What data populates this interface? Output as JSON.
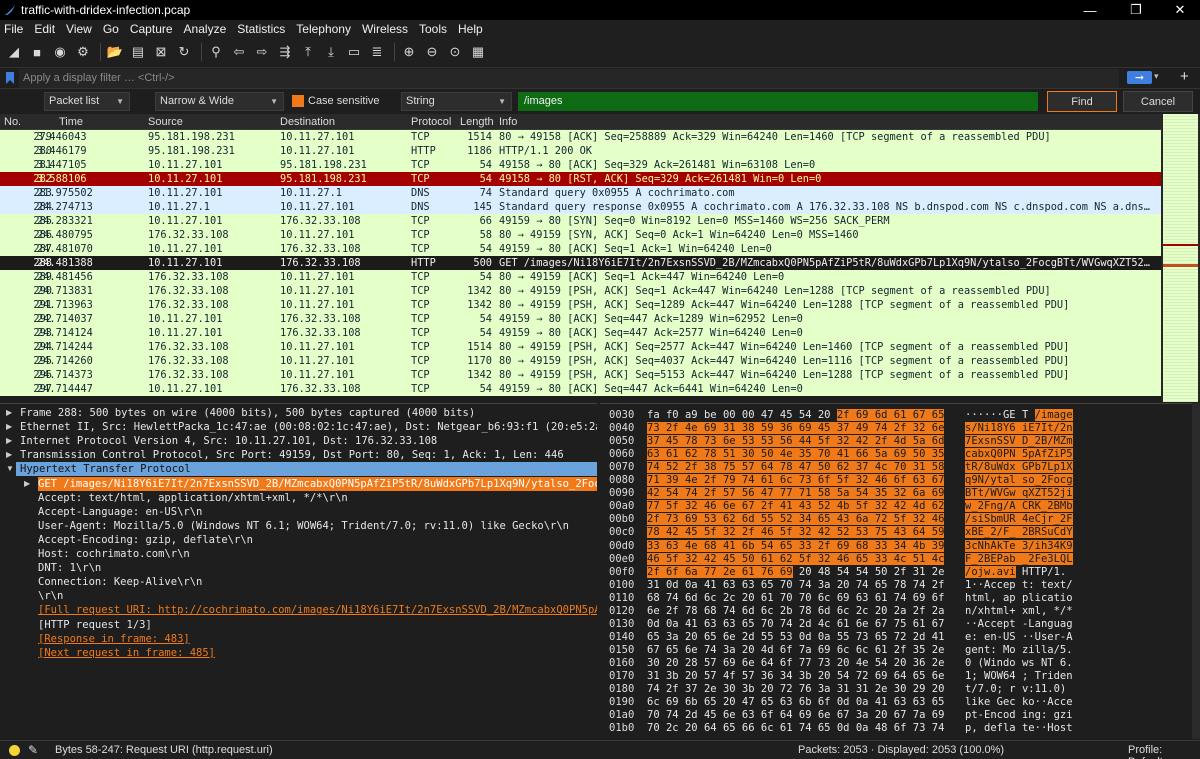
{
  "window": {
    "title": "traffic-with-dridex-infection.pcap",
    "controls": [
      "—",
      "❐",
      "✕"
    ]
  },
  "menu": [
    "File",
    "Edit",
    "View",
    "Go",
    "Capture",
    "Analyze",
    "Statistics",
    "Telephony",
    "Wireless",
    "Tools",
    "Help"
  ],
  "toolbar": {
    "icons": [
      {
        "name": "shark-fin-start-icon",
        "glyph": "◢"
      },
      {
        "name": "stop-capture-icon",
        "glyph": "■"
      },
      {
        "name": "restart-capture-icon",
        "glyph": "◉"
      },
      {
        "name": "capture-options-icon",
        "glyph": "⚙"
      },
      {
        "sep": true
      },
      {
        "name": "open-file-icon",
        "glyph": "📂"
      },
      {
        "name": "save-file-icon",
        "glyph": "▤"
      },
      {
        "name": "close-file-icon",
        "glyph": "⊠"
      },
      {
        "name": "reload-icon",
        "glyph": "↻"
      },
      {
        "sep": true
      },
      {
        "name": "find-packet-icon",
        "glyph": "⚲"
      },
      {
        "name": "go-back-icon",
        "glyph": "⇦"
      },
      {
        "name": "go-forward-icon",
        "glyph": "⇨"
      },
      {
        "name": "go-to-packet-icon",
        "glyph": "⇶"
      },
      {
        "name": "go-first-icon",
        "glyph": "⤒"
      },
      {
        "name": "go-last-icon",
        "glyph": "⤓"
      },
      {
        "name": "autoscroll-icon",
        "glyph": "▭"
      },
      {
        "name": "colorize-icon",
        "glyph": "≣"
      },
      {
        "sep": true
      },
      {
        "name": "zoom-in-icon",
        "glyph": "⊕"
      },
      {
        "name": "zoom-out-icon",
        "glyph": "⊖"
      },
      {
        "name": "zoom-reset-icon",
        "glyph": "⊙"
      },
      {
        "name": "resize-columns-icon",
        "glyph": "▦"
      }
    ]
  },
  "filter": {
    "placeholder": "Apply a display filter … <Ctrl-/>",
    "apply_glyph": "➞",
    "dropdown_glyph": "▾",
    "add_glyph": "+"
  },
  "find": {
    "scope": "Packet list",
    "display": "Narrow & Wide",
    "case_label": "Case sensitive",
    "type": "String",
    "query": "/images",
    "find_label": "Find",
    "cancel_label": "Cancel"
  },
  "packet_list": {
    "columns": [
      "No.",
      "Time",
      "Source",
      "Destination",
      "Protocol",
      "Length",
      "Info"
    ],
    "rows": [
      {
        "no": "279",
        "time": "3.446043",
        "src": "95.181.198.231",
        "dst": "10.11.27.101",
        "proto": "TCP",
        "len": "1514",
        "info": "80 → 49158 [ACK] Seq=258889 Ack=329 Win=64240 Len=1460 [TCP segment of a reassembled PDU]",
        "style": "tcp"
      },
      {
        "no": "280",
        "time": "3.446179",
        "src": "95.181.198.231",
        "dst": "10.11.27.101",
        "proto": "HTTP",
        "len": "1186",
        "info": "HTTP/1.1 200 OK",
        "style": "tcp"
      },
      {
        "no": "281",
        "time": "3.447105",
        "src": "10.11.27.101",
        "dst": "95.181.198.231",
        "proto": "TCP",
        "len": "54",
        "info": "49158 → 80 [ACK] Seq=329 Ack=261481 Win=63108 Len=0",
        "style": "tcp"
      },
      {
        "no": "282",
        "time": "3.588106",
        "src": "10.11.27.101",
        "dst": "95.181.198.231",
        "proto": "TCP",
        "len": "54",
        "info": "49158 → 80 [RST, ACK] Seq=329 Ack=261481 Win=0 Len=0",
        "style": "rst"
      },
      {
        "no": "283",
        "time": "21.975502",
        "src": "10.11.27.101",
        "dst": "10.11.27.1",
        "proto": "DNS",
        "len": "74",
        "info": "Standard query 0x0955 A cochrimato.com",
        "style": "dns"
      },
      {
        "no": "284",
        "time": "24.274713",
        "src": "10.11.27.1",
        "dst": "10.11.27.101",
        "proto": "DNS",
        "len": "145",
        "info": "Standard query response 0x0955 A cochrimato.com A 176.32.33.108 NS b.dnspod.com NS c.dnspod.com NS a.dns…",
        "style": "dns"
      },
      {
        "no": "285",
        "time": "24.283321",
        "src": "10.11.27.101",
        "dst": "176.32.33.108",
        "proto": "TCP",
        "len": "66",
        "info": "49159 → 80 [SYN] Seq=0 Win=8192 Len=0 MSS=1460 WS=256 SACK_PERM",
        "style": "tcp"
      },
      {
        "no": "286",
        "time": "24.480795",
        "src": "176.32.33.108",
        "dst": "10.11.27.101",
        "proto": "TCP",
        "len": "58",
        "info": "80 → 49159 [SYN, ACK] Seq=0 Ack=1 Win=64240 Len=0 MSS=1460",
        "style": "tcp"
      },
      {
        "no": "287",
        "time": "24.481070",
        "src": "10.11.27.101",
        "dst": "176.32.33.108",
        "proto": "TCP",
        "len": "54",
        "info": "49159 → 80 [ACK] Seq=1 Ack=1 Win=64240 Len=0",
        "style": "tcp"
      },
      {
        "no": "288",
        "time": "24.481388",
        "src": "10.11.27.101",
        "dst": "176.32.33.108",
        "proto": "HTTP",
        "len": "500",
        "info": "GET /images/Ni18Y6iE7It/2n7ExsnSSVD_2B/MZmcabxQ0PN5pAfZiP5tR/8uWdxGPb7Lp1Xq9N/ytalso_2FocgBTt/WVGwqXZT52…",
        "style": "sel"
      },
      {
        "no": "289",
        "time": "24.481456",
        "src": "176.32.33.108",
        "dst": "10.11.27.101",
        "proto": "TCP",
        "len": "54",
        "info": "80 → 49159 [ACK] Seq=1 Ack=447 Win=64240 Len=0",
        "style": "tcp"
      },
      {
        "no": "290",
        "time": "24.713831",
        "src": "176.32.33.108",
        "dst": "10.11.27.101",
        "proto": "TCP",
        "len": "1342",
        "info": "80 → 49159 [PSH, ACK] Seq=1 Ack=447 Win=64240 Len=1288 [TCP segment of a reassembled PDU]",
        "style": "tcp"
      },
      {
        "no": "291",
        "time": "24.713963",
        "src": "176.32.33.108",
        "dst": "10.11.27.101",
        "proto": "TCP",
        "len": "1342",
        "info": "80 → 49159 [PSH, ACK] Seq=1289 Ack=447 Win=64240 Len=1288 [TCP segment of a reassembled PDU]",
        "style": "tcp"
      },
      {
        "no": "292",
        "time": "24.714037",
        "src": "10.11.27.101",
        "dst": "176.32.33.108",
        "proto": "TCP",
        "len": "54",
        "info": "49159 → 80 [ACK] Seq=447 Ack=1289 Win=62952 Len=0",
        "style": "tcp"
      },
      {
        "no": "293",
        "time": "24.714124",
        "src": "10.11.27.101",
        "dst": "176.32.33.108",
        "proto": "TCP",
        "len": "54",
        "info": "49159 → 80 [ACK] Seq=447 Ack=2577 Win=64240 Len=0",
        "style": "tcp"
      },
      {
        "no": "294",
        "time": "24.714244",
        "src": "176.32.33.108",
        "dst": "10.11.27.101",
        "proto": "TCP",
        "len": "1514",
        "info": "80 → 49159 [PSH, ACK] Seq=2577 Ack=447 Win=64240 Len=1460 [TCP segment of a reassembled PDU]",
        "style": "tcp"
      },
      {
        "no": "295",
        "time": "24.714260",
        "src": "176.32.33.108",
        "dst": "10.11.27.101",
        "proto": "TCP",
        "len": "1170",
        "info": "80 → 49159 [PSH, ACK] Seq=4037 Ack=447 Win=64240 Len=1116 [TCP segment of a reassembled PDU]",
        "style": "tcp"
      },
      {
        "no": "296",
        "time": "24.714373",
        "src": "176.32.33.108",
        "dst": "10.11.27.101",
        "proto": "TCP",
        "len": "1342",
        "info": "80 → 49159 [PSH, ACK] Seq=5153 Ack=447 Win=64240 Len=1288 [TCP segment of a reassembled PDU]",
        "style": "tcp"
      },
      {
        "no": "297",
        "time": "24.714447",
        "src": "10.11.27.101",
        "dst": "176.32.33.108",
        "proto": "TCP",
        "len": "54",
        "info": "49159 → 80 [ACK] Seq=447 Ack=6441 Win=64240 Len=0",
        "style": "tcp"
      }
    ]
  },
  "details": [
    {
      "text": "Frame 288: 500 bytes on wire (4000 bits), 500 bytes captured (4000 bits)",
      "indent": 0,
      "tri": "▶",
      "style": ""
    },
    {
      "text": "Ethernet II, Src: HewlettPacka_1c:47:ae (00:08:02:1c:47:ae), Dst: Netgear_b6:93:f1 (20:e5:2a",
      "indent": 0,
      "tri": "▶",
      "style": ""
    },
    {
      "text": "Internet Protocol Version 4, Src: 10.11.27.101, Dst: 176.32.33.108",
      "indent": 0,
      "tri": "▶",
      "style": ""
    },
    {
      "text": "Transmission Control Protocol, Src Port: 49159, Dst Port: 80, Seq: 1, Ack: 1, Len: 446",
      "indent": 0,
      "tri": "▶",
      "style": ""
    },
    {
      "text": "Hypertext Transfer Protocol",
      "indent": 0,
      "tri": "▼",
      "style": "hl"
    },
    {
      "text": "GET /images/Ni18Y6iE7It/2n7ExsnSSVD_2B/MZmcabxQ0PN5pAfZiP5tR/8uWdxGPb7Lp1Xq9N/ytalso_2Foc",
      "indent": 1,
      "tri": "▶",
      "style": "fieldsel"
    },
    {
      "text": "Accept: text/html, application/xhtml+xml, */*\\r\\n",
      "indent": 1,
      "tri": "",
      "style": ""
    },
    {
      "text": "Accept-Language: en-US\\r\\n",
      "indent": 1,
      "tri": "",
      "style": ""
    },
    {
      "text": "User-Agent: Mozilla/5.0 (Windows NT 6.1; WOW64; Trident/7.0; rv:11.0) like Gecko\\r\\n",
      "indent": 1,
      "tri": "",
      "style": ""
    },
    {
      "text": "Accept-Encoding: gzip, deflate\\r\\n",
      "indent": 1,
      "tri": "",
      "style": ""
    },
    {
      "text": "Host: cochrimato.com\\r\\n",
      "indent": 1,
      "tri": "",
      "style": ""
    },
    {
      "text": "DNT: 1\\r\\n",
      "indent": 1,
      "tri": "",
      "style": ""
    },
    {
      "text": "Connection: Keep-Alive\\r\\n",
      "indent": 1,
      "tri": "",
      "style": ""
    },
    {
      "text": "\\r\\n",
      "indent": 1,
      "tri": "",
      "style": ""
    },
    {
      "text": "[Full request URI: http://cochrimato.com/images/Ni18Y6iE7It/2n7ExsnSSVD_2B/MZmcabxQ0PN5pA",
      "indent": 1,
      "tri": "",
      "style": "link"
    },
    {
      "text": "[HTTP request 1/3]",
      "indent": 1,
      "tri": "",
      "style": ""
    },
    {
      "text": "[Response in frame: 483]",
      "indent": 1,
      "tri": "",
      "style": "link"
    },
    {
      "text": "[Next request in frame: 485]",
      "indent": 1,
      "tri": "",
      "style": "link"
    }
  ],
  "hex": [
    {
      "off": "0030",
      "hex": "fa f0 a9 be 00 00 47 45  54 20 2f 69 6d 61 67 65",
      "ascii": "······GE T /image",
      "hl_from": 10,
      "asc_hl_from": 10
    },
    {
      "off": "0040",
      "hex": "73 2f 4e 69 31 38 59 36  69 45 37 49 74 2f 32 6e",
      "ascii": "s/Ni18Y6 iE7It/2n",
      "hl_from": 0,
      "asc_hl_from": 0
    },
    {
      "off": "0050",
      "hex": "37 45 78 73 6e 53 53 56  44 5f 32 42 2f 4d 5a 6d",
      "ascii": "7ExsnSSV D_2B/MZm",
      "hl_from": 0,
      "asc_hl_from": 0
    },
    {
      "off": "0060",
      "hex": "63 61 62 78 51 30 50 4e  35 70 41 66 5a 69 50 35",
      "ascii": "cabxQ0PN 5pAfZiP5",
      "hl_from": 0,
      "asc_hl_from": 0
    },
    {
      "off": "0070",
      "hex": "74 52 2f 38 75 57 64 78  47 50 62 37 4c 70 31 58",
      "ascii": "tR/8uWdx GPb7Lp1X",
      "hl_from": 0,
      "asc_hl_from": 0
    },
    {
      "off": "0080",
      "hex": "71 39 4e 2f 79 74 61 6c  73 6f 5f 32 46 6f 63 67",
      "ascii": "q9N/ytal so_2Focg",
      "hl_from": 0,
      "asc_hl_from": 0
    },
    {
      "off": "0090",
      "hex": "42 54 74 2f 57 56 47 77  71 58 5a 54 35 32 6a 69",
      "ascii": "BTt/WVGw qXZT52ji",
      "hl_from": 0,
      "asc_hl_from": 0
    },
    {
      "off": "00a0",
      "hex": "77 5f 32 46 6e 67 2f 41  43 52 4b 5f 32 42 4d 62",
      "ascii": "w_2Fng/A CRK_2BMb",
      "hl_from": 0,
      "asc_hl_from": 0
    },
    {
      "off": "00b0",
      "hex": "2f 73 69 53 62 6d 55 52  34 65 43 6a 72 5f 32 46",
      "ascii": "/siSbmUR 4eCjr_2F",
      "hl_from": 0,
      "asc_hl_from": 0
    },
    {
      "off": "00c0",
      "hex": "78 42 45 5f 32 2f 46 5f  32 42 52 53 75 43 64 59",
      "ascii": "xBE_2/F_ 2BRSuCdY",
      "hl_from": 0,
      "asc_hl_from": 0
    },
    {
      "off": "00d0",
      "hex": "33 63 4e 68 41 6b 54 65  33 2f 69 68 33 34 4b 39",
      "ascii": "3cNhAkTe 3/ih34K9",
      "hl_from": 0,
      "asc_hl_from": 0
    },
    {
      "off": "00e0",
      "hex": "46 5f 32 42 45 50 61 62  5f 32 46 65 33 4c 51 4c",
      "ascii": "F_2BEPab _2Fe3LQL",
      "hl_from": 0,
      "asc_hl_from": 0
    },
    {
      "off": "00f0",
      "hex": "2f 6f 6a 77 2e 61 76 69  20 48 54 54 50 2f 31 2e",
      "ascii": "/ojw.avi  HTTP/1.",
      "hl_to": 8,
      "asc_hl_to": 8
    },
    {
      "off": "0100",
      "hex": "31 0d 0a 41 63 63 65 70  74 3a 20 74 65 78 74 2f",
      "ascii": "1··Accep t: text/"
    },
    {
      "off": "0110",
      "hex": "68 74 6d 6c 2c 20 61 70  70 6c 69 63 61 74 69 6f",
      "ascii": "html, ap plicatio"
    },
    {
      "off": "0120",
      "hex": "6e 2f 78 68 74 6d 6c 2b  78 6d 6c 2c 20 2a 2f 2a",
      "ascii": "n/xhtml+ xml, */*"
    },
    {
      "off": "0130",
      "hex": "0d 0a 41 63 63 65 70 74  2d 4c 61 6e 67 75 61 67",
      "ascii": "··Accept -Languag"
    },
    {
      "off": "0140",
      "hex": "65 3a 20 65 6e 2d 55 53  0d 0a 55 73 65 72 2d 41",
      "ascii": "e: en-US ··User-A"
    },
    {
      "off": "0150",
      "hex": "67 65 6e 74 3a 20 4d 6f  7a 69 6c 6c 61 2f 35 2e",
      "ascii": "gent: Mo zilla/5."
    },
    {
      "off": "0160",
      "hex": "30 20 28 57 69 6e 64 6f  77 73 20 4e 54 20 36 2e",
      "ascii": "0 (Windo ws NT 6."
    },
    {
      "off": "0170",
      "hex": "31 3b 20 57 4f 57 36 34  3b 20 54 72 69 64 65 6e",
      "ascii": "1; WOW64 ; Triden"
    },
    {
      "off": "0180",
      "hex": "74 2f 37 2e 30 3b 20 72  76 3a 31 31 2e 30 29 20",
      "ascii": "t/7.0; r v:11.0) "
    },
    {
      "off": "0190",
      "hex": "6c 69 6b 65 20 47 65 63  6b 6f 0d 0a 41 63 63 65",
      "ascii": "like Gec ko··Acce"
    },
    {
      "off": "01a0",
      "hex": "70 74 2d 45 6e 63 6f 64  69 6e 67 3a 20 67 7a 69",
      "ascii": "pt-Encod ing: gzi"
    },
    {
      "off": "01b0",
      "hex": "70 2c 20 64 65 66 6c 61  74 65 0d 0a 48 6f 73 74",
      "ascii": "p, defla te··Host"
    }
  ],
  "status": {
    "bytes": "Bytes 58-247: Request URI (http.request.uri)",
    "packets": "Packets: 2053 · Displayed: 2053 (100.0%)",
    "profile": "Profile: Default"
  },
  "colors": {
    "tcp_row": "#e4ffc7",
    "dns_row": "#daeeff",
    "rst_row": "#a40000",
    "selected_row": "#1b1b1b",
    "highlight": "#f07a1a",
    "find_field": "#0e6b14"
  }
}
